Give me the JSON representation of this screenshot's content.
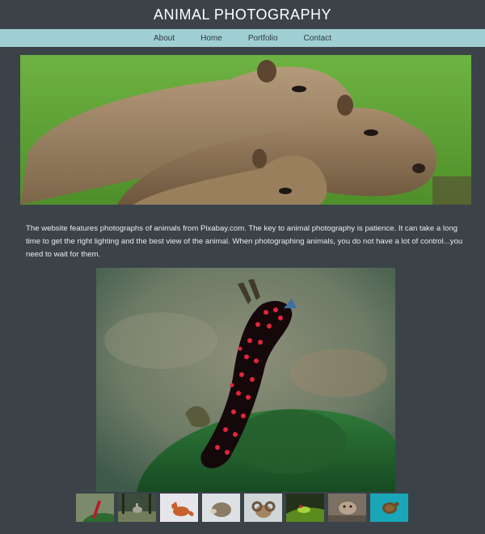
{
  "header": {
    "title": "ANIMAL PHOTOGRAPHY"
  },
  "nav": {
    "items": [
      {
        "label": "About"
      },
      {
        "label": "Home"
      },
      {
        "label": "Portfolio"
      },
      {
        "label": "Contact"
      }
    ]
  },
  "hero": {
    "subject": "capybaras",
    "icon": "capybara-photo"
  },
  "intro": {
    "text": "The website features photographs of animals from Pixabay.com. The key to animal photography is patience. It can take a long time to get the right lighting and the best view of the animal. When photographing animals, you do not have a lot of control...you need to wait for them."
  },
  "feature": {
    "subject": "red-spotted nudibranch",
    "icon": "nudibranch-photo"
  },
  "thumbnails": [
    {
      "subject": "nudibranch",
      "icon": "nudibranch-thumb"
    },
    {
      "subject": "deer",
      "icon": "deer-thumb"
    },
    {
      "subject": "fox",
      "icon": "fox-thumb"
    },
    {
      "subject": "hedgehog",
      "icon": "hedgehog-thumb"
    },
    {
      "subject": "ram",
      "icon": "ram-thumb"
    },
    {
      "subject": "frog",
      "icon": "frog-thumb"
    },
    {
      "subject": "otter",
      "icon": "otter-thumb"
    },
    {
      "subject": "turtle",
      "icon": "turtle-thumb"
    }
  ],
  "colors": {
    "background": "#3b4349",
    "nav": "#9fcfd3",
    "title": "#ffffff"
  }
}
